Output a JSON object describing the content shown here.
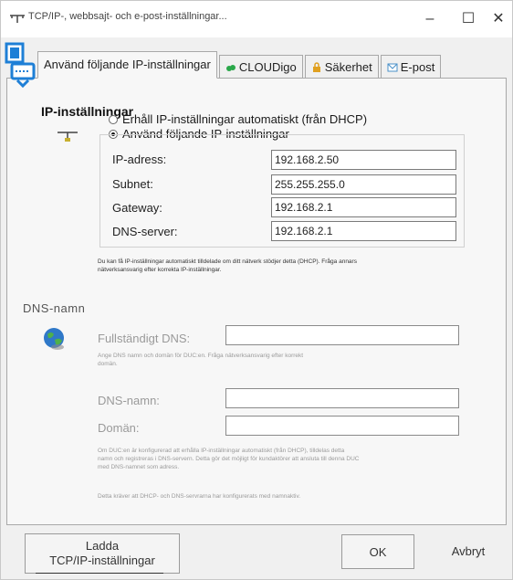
{
  "window": {
    "title": "TCP/IP-, webbsajt- och e-post-inställningar...",
    "minimize": "–",
    "maximize": "☐",
    "close": "✕"
  },
  "tabs": [
    {
      "label": "Använd följande IP-inställningar",
      "icon": "network-icon"
    },
    {
      "label": "CLOUDigo",
      "icon": "cloud-icon"
    },
    {
      "label": "Säkerhet",
      "icon": "lock-icon"
    },
    {
      "label": "E-post",
      "icon": "mail-icon"
    }
  ],
  "ip_section": {
    "title": "IP-inställningar",
    "radio_dhcp": "Erhåll IP-inställningar automatiskt (från DHCP)",
    "radio_manual": "Använd följande IP-inställningar",
    "selected": "manual",
    "fields": [
      {
        "label": "IP-adress:",
        "value": "192.168.2.50"
      },
      {
        "label": "Subnet:",
        "value": "255.255.255.0"
      },
      {
        "label": "Gateway:",
        "value": "192.168.2.1"
      },
      {
        "label": "DNS-server:",
        "value": "192.168.2.1"
      }
    ],
    "note_line1": "Du kan få IP-inställningar automatiskt tilldelade om ditt nätverk stödjer detta (DHCP). Fråga annars",
    "note_line2": "nätverksansvarig efter korrekta IP-inställningar."
  },
  "dns_section": {
    "title": "DNS-namn",
    "fqdn_label": "Fullständigt DNS:",
    "fqdn_value": "",
    "fqdn_help_line1": "Ange DNS namn och domän för DUC:en. Fråga nätverksansvarig efter korrekt",
    "fqdn_help_line2": "domän.",
    "dnsname_label": "DNS-namn:",
    "dnsname_value": "",
    "domain_label": "Domän:",
    "domain_value": "",
    "help_line1": "Om DUC:en är konfigurerad att erhålla IP-inställningar automatiskt (från DHCP), tilldelas detta",
    "help_line2": "namn och registreras i DNS-servern. Detta gör det möjligt för kundaktörer att ansluta till denna DUC",
    "help_line3": "med DNS-namnet som adress.",
    "help_line4": "Detta kräver att DHCP- och DNS-servrarna har konfigurerats med namnaktiv."
  },
  "footer": {
    "load_line1": "Ladda",
    "load_line2": "TCP/IP-inställningar",
    "ok": "OK",
    "cancel": "Avbryt"
  }
}
